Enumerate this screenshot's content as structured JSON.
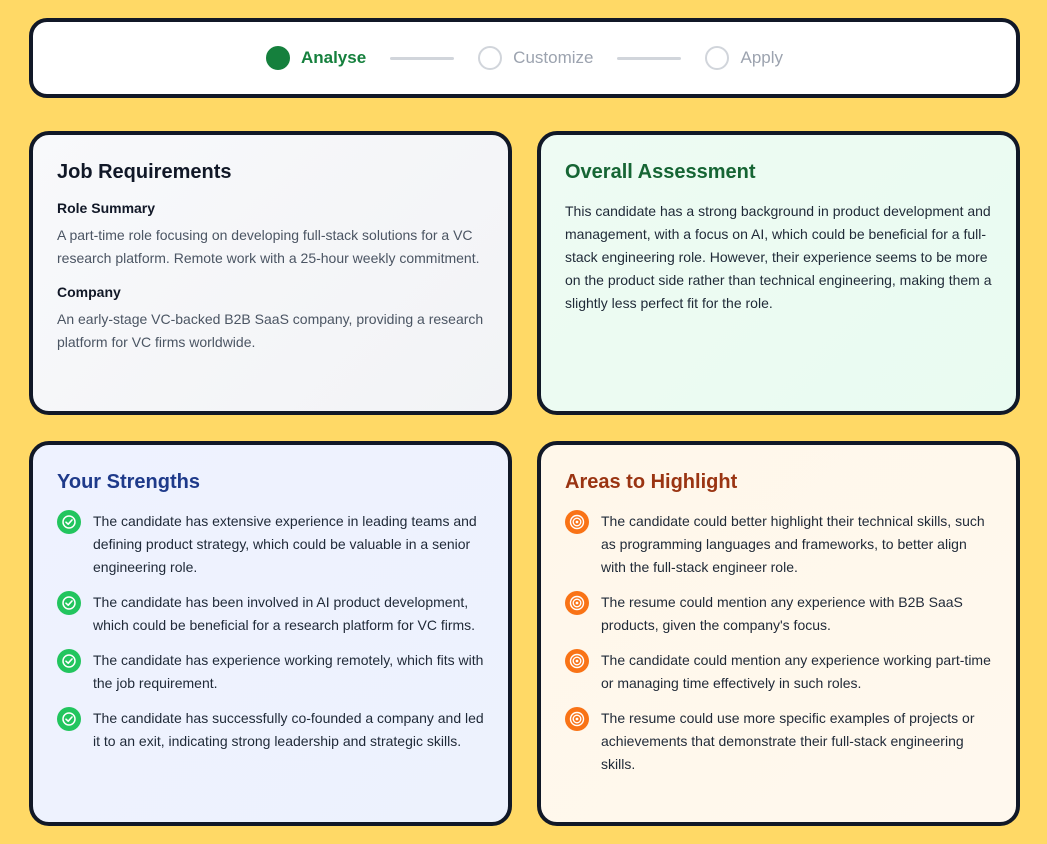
{
  "stepper": {
    "steps": [
      {
        "label": "Analyse",
        "state": "active"
      },
      {
        "label": "Customize",
        "state": "inactive"
      },
      {
        "label": "Apply",
        "state": "inactive"
      }
    ]
  },
  "job_requirements": {
    "title": "Job Requirements",
    "role_summary_title": "Role Summary",
    "role_summary_text": "A part-time role focusing on developing full-stack solutions for a VC research platform. Remote work with a 25-hour weekly commitment.",
    "company_title": "Company",
    "company_text": "An early-stage VC-backed B2B SaaS company, providing a research platform for VC firms worldwide."
  },
  "overall_assessment": {
    "title": "Overall Assessment",
    "text": "This candidate has a strong background in product development and management, with a focus on AI, which could be beneficial for a full-stack engineering role. However, their experience seems to be more on the product side rather than technical engineering, making them a slightly less perfect fit for the role."
  },
  "strengths": {
    "title": "Your Strengths",
    "items": [
      "The candidate has extensive experience in leading teams and defining product strategy, which could be valuable in a senior engineering role.",
      "The candidate has been involved in AI product development, which could be beneficial for a research platform for VC firms.",
      "The candidate has experience working remotely, which fits with the job requirement.",
      "The candidate has successfully co-founded a company and led it to an exit, indicating strong leadership and strategic skills."
    ]
  },
  "areas_to_highlight": {
    "title": "Areas to Highlight",
    "items": [
      "The candidate could better highlight their technical skills, such as programming languages and frameworks, to better align with the full-stack engineer role.",
      "The resume could mention any experience with B2B SaaS products, given the company's focus.",
      "The candidate could mention any experience working part-time or managing time effectively in such roles.",
      "The resume could use more specific examples of projects or achievements that demonstrate their full-stack engineering skills."
    ]
  },
  "colors": {
    "background": "#FFD966",
    "active_step": "#15803d",
    "check_icon": "#22c55e",
    "target_icon": "#f97316"
  },
  "icons": {
    "strength_item": "check-circle-icon",
    "highlight_item": "target-icon"
  }
}
